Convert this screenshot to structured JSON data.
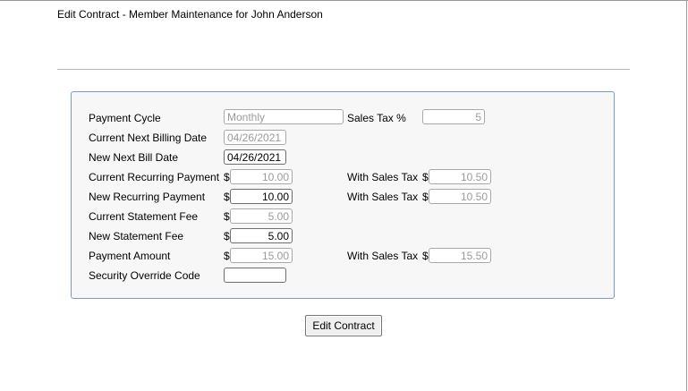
{
  "page": {
    "title": "Edit Contract - Member Maintenance for John Anderson"
  },
  "form": {
    "payment_cycle": {
      "label": "Payment Cycle",
      "value": "Monthly"
    },
    "sales_tax": {
      "label": "Sales Tax %",
      "value": "5"
    },
    "current_next_billing_date": {
      "label": "Current Next Billing Date",
      "value": "04/26/2021"
    },
    "new_next_bill_date": {
      "label": "New Next Bill Date",
      "value": "04/26/2021"
    },
    "current_recurring_payment": {
      "label": "Current Recurring Payment",
      "currency": "$",
      "value": "10.00",
      "with_tax_label": "With Sales Tax",
      "with_tax_currency": "$",
      "with_tax_value": "10.50"
    },
    "new_recurring_payment": {
      "label": "New Recurring Payment",
      "currency": "$",
      "value": "10.00",
      "with_tax_label": "With Sales Tax",
      "with_tax_currency": "$",
      "with_tax_value": "10.50"
    },
    "current_statement_fee": {
      "label": "Current Statement Fee",
      "currency": "$",
      "value": "5.00"
    },
    "new_statement_fee": {
      "label": "New Statement Fee",
      "currency": "$",
      "value": "5.00"
    },
    "payment_amount": {
      "label": "Payment Amount",
      "currency": "$",
      "value": "15.00",
      "with_tax_label": "With Sales Tax",
      "with_tax_currency": "$",
      "with_tax_value": "15.50"
    },
    "security_override_code": {
      "label": "Security Override Code",
      "value": ""
    }
  },
  "actions": {
    "edit_contract_label": "Edit Contract"
  }
}
